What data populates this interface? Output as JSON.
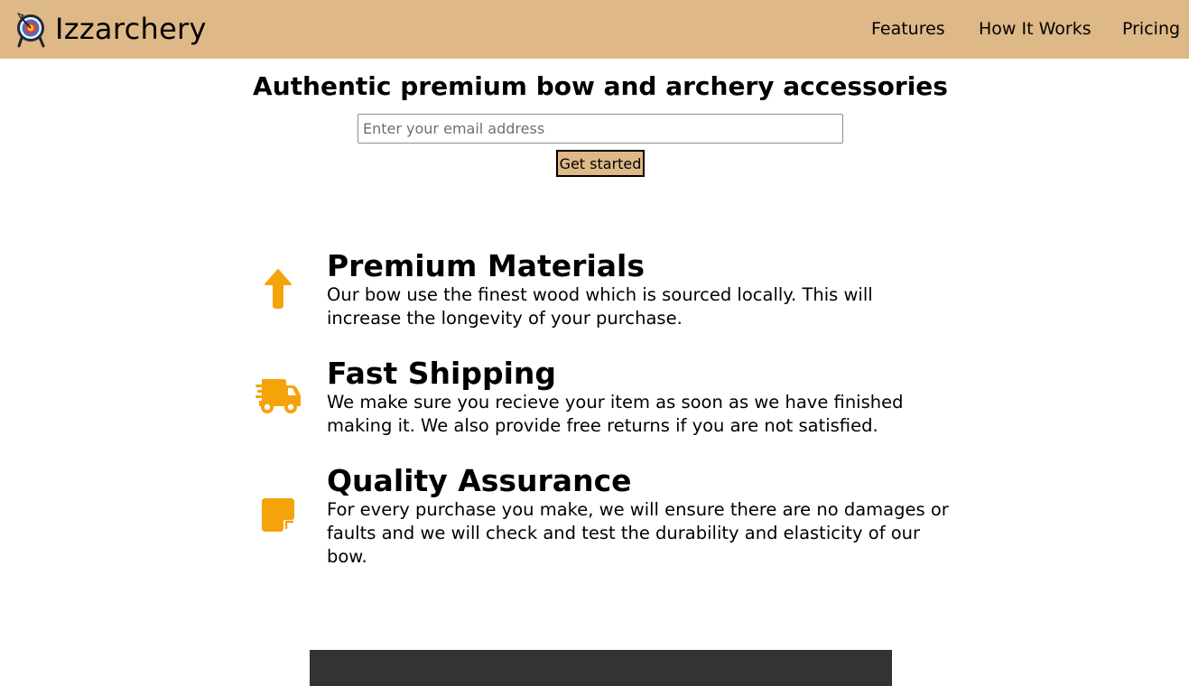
{
  "header": {
    "logo_icon": "archery-target-icon",
    "brand": "Izzarchery",
    "background_color": "#deb887",
    "nav": [
      {
        "label": "Features"
      },
      {
        "label": "How It Works"
      },
      {
        "label": "Pricing"
      }
    ]
  },
  "hero": {
    "title": "Authentic premium bow and archery accessories",
    "email_placeholder": "Enter your email address",
    "cta_label": "Get started"
  },
  "features": {
    "accent_color": "#f5a30a",
    "items": [
      {
        "icon": "arrow-up-icon",
        "title": "Premium Materials",
        "text": "Our bow use the finest wood which is sourced locally. This will increase the longevity of your purchase."
      },
      {
        "icon": "shipping-truck-icon",
        "title": "Fast Shipping",
        "text": "We make sure you recieve your item as soon as we have finished making it. We also provide free returns if you are not satisfied."
      },
      {
        "icon": "sticky-note-icon",
        "title": "Quality Assurance",
        "text": "For every purchase you make, we will ensure there are no damages or faults and we will check and test the durability and elasticity of our bow."
      }
    ]
  },
  "footer": {
    "background_color": "#333333"
  }
}
